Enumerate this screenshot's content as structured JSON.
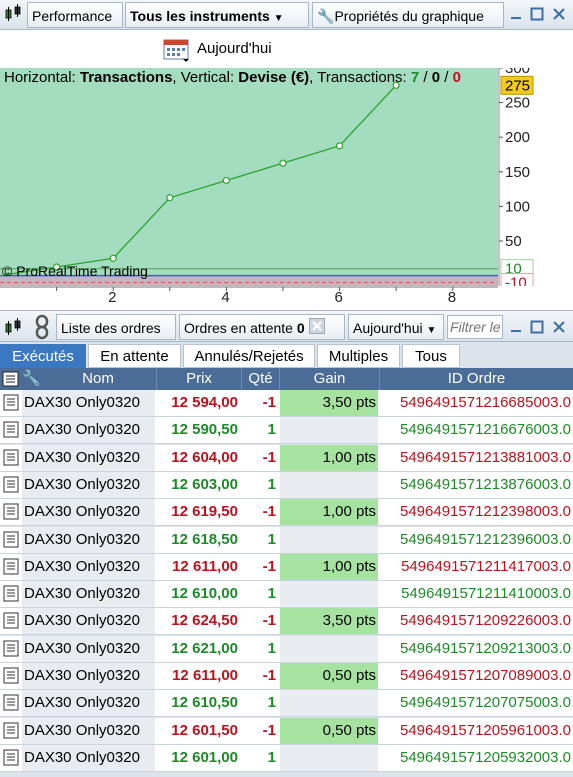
{
  "colors": {
    "accent": "#3b78c2",
    "header_bg": "#4a6c96",
    "sell": "#c0101c",
    "buy": "#1d8a28",
    "gain_fill": "#a7e3a0",
    "chart_fill": "#a4dcc0",
    "chart_line": "#2aa52a",
    "badge": "#f2cb1d"
  },
  "toolbar": {
    "perf_label": "Performance",
    "instrument_label": "Tous les instruments",
    "properties_label": "Propriétés du graphique"
  },
  "date": {
    "label": "Aujourd'hui"
  },
  "chart": {
    "header_prefix": "Horizontal: ",
    "horizontal": "Transactions",
    "vertical_prefix": ", Vertical: ",
    "vertical": "Devise (€)",
    "trans_prefix": ", Transactions: ",
    "trans_win": "7",
    "sep1": " / ",
    "trans_neutral": "0",
    "sep2": " / ",
    "trans_loss": "0",
    "copyright": "© ProRealTime Trading",
    "last_badge": "275",
    "zero_badge": "10",
    "neg_badge": "-10"
  },
  "chart_data": {
    "type": "line",
    "x": [
      0,
      1,
      2,
      3,
      4,
      5,
      6,
      7
    ],
    "values": [
      0,
      12.5,
      25,
      112.5,
      137.5,
      162.5,
      187.5,
      275
    ],
    "xlabel": "Transactions",
    "ylabel": "Devise (€)",
    "xlim": [
      0,
      8.8
    ],
    "ylim": [
      -15,
      300
    ],
    "xticks": [
      2,
      4,
      6,
      8
    ],
    "yticks": [
      50,
      100,
      150,
      200,
      250,
      300
    ],
    "grid": false,
    "legend": "none"
  },
  "orders": {
    "list_label": "Liste des ordres",
    "pending_label": "Ordres en attente",
    "pending_count": "0",
    "date_label": "Aujourd'hui",
    "filter_placeholder": "Filtrer le"
  },
  "tabs": [
    {
      "label": "Exécutés",
      "active": true
    },
    {
      "label": "En attente",
      "active": false
    },
    {
      "label": "Annulés/Rejetés",
      "active": false
    },
    {
      "label": "Multiples",
      "active": false
    },
    {
      "label": "Tous",
      "active": false
    }
  ],
  "columns": {
    "nom": "Nom",
    "prix": "Prix",
    "qte": "Qté",
    "gain": "Gain",
    "id": "ID Ordre"
  },
  "rows": [
    {
      "nom": "DAX30 Only0320",
      "prix": "12 594,00",
      "qte": "-1",
      "gain": "3,50 pts",
      "id": "5496491571216685003.0",
      "side": "sell"
    },
    {
      "nom": "DAX30 Only0320",
      "prix": "12 590,50",
      "qte": "1",
      "gain": "",
      "id": "5496491571216676003.0",
      "side": "buy"
    },
    {
      "nom": "DAX30 Only0320",
      "prix": "12 604,00",
      "qte": "-1",
      "gain": "1,00 pts",
      "id": "5496491571213881003.0",
      "side": "sell"
    },
    {
      "nom": "DAX30 Only0320",
      "prix": "12 603,00",
      "qte": "1",
      "gain": "",
      "id": "5496491571213876003.0",
      "side": "buy"
    },
    {
      "nom": "DAX30 Only0320",
      "prix": "12 619,50",
      "qte": "-1",
      "gain": "1,00 pts",
      "id": "5496491571212398003.0",
      "side": "sell"
    },
    {
      "nom": "DAX30 Only0320",
      "prix": "12 618,50",
      "qte": "1",
      "gain": "",
      "id": "5496491571212396003.0",
      "side": "buy"
    },
    {
      "nom": "DAX30 Only0320",
      "prix": "12 611,00",
      "qte": "-1",
      "gain": "1,00 pts",
      "id": "5496491571211417003.0",
      "side": "sell"
    },
    {
      "nom": "DAX30 Only0320",
      "prix": "12 610,00",
      "qte": "1",
      "gain": "",
      "id": "5496491571211410003.0",
      "side": "buy"
    },
    {
      "nom": "DAX30 Only0320",
      "prix": "12 624,50",
      "qte": "-1",
      "gain": "3,50 pts",
      "id": "5496491571209226003.0",
      "side": "sell"
    },
    {
      "nom": "DAX30 Only0320",
      "prix": "12 621,00",
      "qte": "1",
      "gain": "",
      "id": "5496491571209213003.0",
      "side": "buy"
    },
    {
      "nom": "DAX30 Only0320",
      "prix": "12 611,00",
      "qte": "-1",
      "gain": "0,50 pts",
      "id": "5496491571207089003.0",
      "side": "sell"
    },
    {
      "nom": "DAX30 Only0320",
      "prix": "12 610,50",
      "qte": "1",
      "gain": "",
      "id": "5496491571207075003.0",
      "side": "buy"
    },
    {
      "nom": "DAX30 Only0320",
      "prix": "12 601,50",
      "qte": "-1",
      "gain": "0,50 pts",
      "id": "5496491571205961003.0",
      "side": "sell"
    },
    {
      "nom": "DAX30 Only0320",
      "prix": "12 601,00",
      "qte": "1",
      "gain": "",
      "id": "5496491571205932003.0",
      "side": "buy"
    }
  ]
}
